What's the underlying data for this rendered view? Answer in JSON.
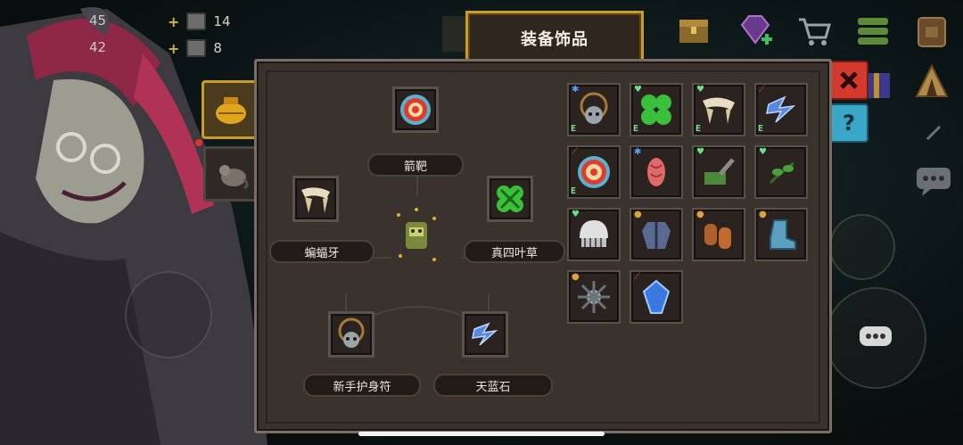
{
  "header": {
    "title": "装备饰品"
  },
  "resources": [
    {
      "value": "45",
      "icon": "coin-icon"
    },
    {
      "value": "42",
      "icon": "gem-icon"
    }
  ],
  "materials": [
    {
      "plus": "+",
      "value": "14",
      "icon": "fish-material-icon"
    },
    {
      "plus": "+",
      "value": "8",
      "icon": "ore-material-icon"
    }
  ],
  "equipped": {
    "top": {
      "label": "箭靶",
      "icon": "target-icon"
    },
    "left": {
      "label": "蝙蝠牙",
      "icon": "bat-fang-icon"
    },
    "right": {
      "label": "真四叶草",
      "icon": "clover-icon"
    },
    "bottom_left": {
      "label": "新手护身符",
      "icon": "amulet-icon"
    },
    "bottom_right": {
      "label": "天蓝石",
      "icon": "sky-stone-icon"
    },
    "center": {
      "icon": "character-icon"
    }
  },
  "inventory": [
    {
      "icon": "amulet-icon",
      "equipped": true,
      "tag": "star"
    },
    {
      "icon": "clover-icon",
      "equipped": true,
      "tag": "heart"
    },
    {
      "icon": "bat-fang-icon",
      "equipped": true,
      "tag": "heart"
    },
    {
      "icon": "sky-stone-icon",
      "equipped": true,
      "tag": "sword"
    },
    {
      "icon": "target-icon",
      "equipped": true,
      "tag": "sword"
    },
    {
      "icon": "meat-icon",
      "equipped": false,
      "tag": "star"
    },
    {
      "icon": "slingshot-icon",
      "equipped": false,
      "tag": "heart"
    },
    {
      "icon": "herb-icon",
      "equipped": false,
      "tag": "heart"
    },
    {
      "icon": "skull-helmet-icon",
      "equipped": false,
      "tag": "heart"
    },
    {
      "icon": "armor-icon",
      "equipped": false,
      "tag": "pin"
    },
    {
      "icon": "sausage-icon",
      "equipped": false,
      "tag": "pin"
    },
    {
      "icon": "boot-icon",
      "equipped": false,
      "tag": "pin"
    },
    {
      "icon": "spiky-gear-icon",
      "equipped": false,
      "tag": "pin"
    },
    {
      "icon": "blue-crystal-icon",
      "equipped": false,
      "tag": "sword"
    }
  ],
  "badge_letter": "E",
  "sidebar_tabs": [
    {
      "icon": "honey-jar-icon",
      "active": true
    },
    {
      "icon": "rat-icon",
      "active": false
    }
  ],
  "top_right_icons": [
    "chest-icon",
    "diamond-plus-icon",
    "cart-icon",
    "list-icon",
    "backpack-icon"
  ],
  "buttons": {
    "close_icon": "close-icon",
    "help_label": "?",
    "chat_icon": "chat-icon"
  },
  "colors": {
    "accent_gold": "#c99b2b",
    "close_red": "#d23a2e",
    "help_blue": "#3aa6c8"
  }
}
